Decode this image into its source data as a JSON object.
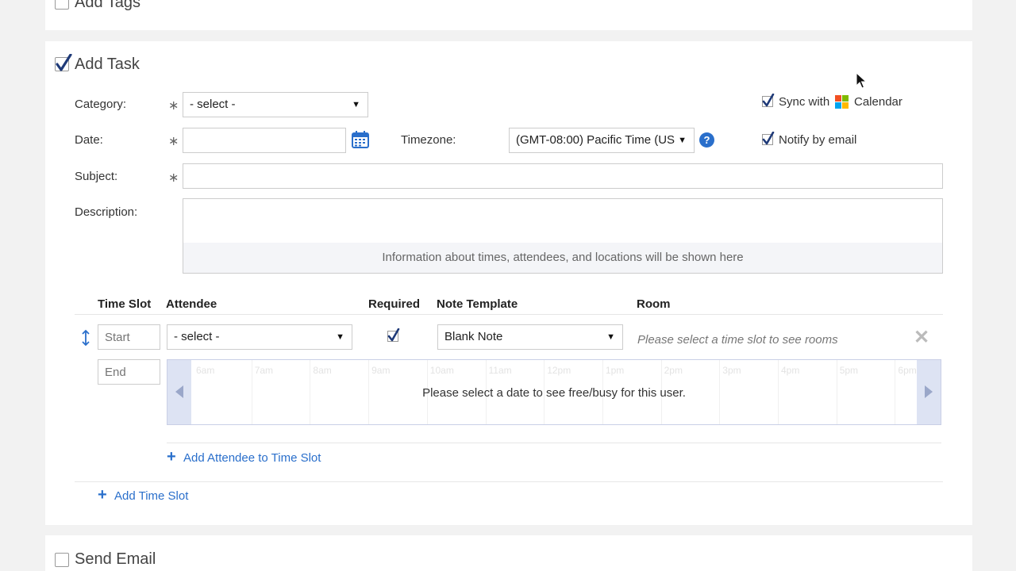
{
  "sections": {
    "add_tags": "Add Tags",
    "add_task": "Add Task",
    "send_email": "Send Email"
  },
  "form": {
    "category_label": "Category:",
    "category_value": "- select -",
    "date_label": "Date:",
    "timezone_label": "Timezone:",
    "timezone_value": "(GMT-08:00) Pacific Time (US",
    "subject_label": "Subject:",
    "description_label": "Description:",
    "description_info": "Information about times, attendees, and locations will be shown here",
    "required_mark": "∗",
    "help_glyph": "?"
  },
  "options": {
    "sync_prefix": "Sync with",
    "sync_suffix": "Calendar",
    "notify": "Notify by email"
  },
  "timeslots": {
    "headers": {
      "time_slot": "Time Slot",
      "attendee": "Attendee",
      "required": "Required",
      "note_template": "Note Template",
      "room": "Room"
    },
    "start_placeholder": "Start",
    "end_placeholder": "End",
    "attendee_value": "- select -",
    "note_template_value": "Blank Note",
    "rooms_message": "Please select a time slot to see rooms",
    "hours": [
      "6am",
      "7am",
      "8am",
      "9am",
      "10am",
      "11am",
      "12pm",
      "1pm",
      "2pm",
      "3pm",
      "4pm",
      "5pm",
      "6pm"
    ],
    "freebusy_message": "Please select a date to see free/busy for this user.",
    "add_attendee": "Add Attendee to Time Slot",
    "add_time_slot": "Add Time Slot"
  },
  "colors": {
    "link": "#2a6fcb",
    "ms_red": "#f25022",
    "ms_green": "#7fba00",
    "ms_blue": "#00a4ef",
    "ms_yellow": "#ffb900"
  }
}
